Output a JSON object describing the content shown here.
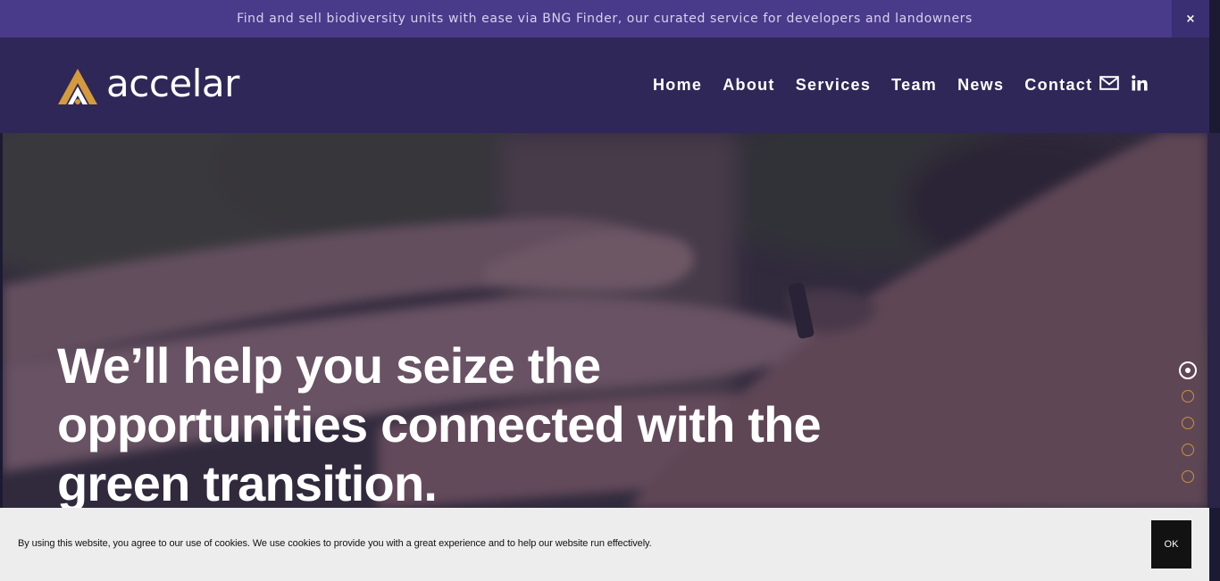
{
  "announcement": {
    "text": "Find and sell biodiversity units with ease via BNG Finder, our curated service for developers and landowners",
    "close_label": "×"
  },
  "header": {
    "logo_text": "accelar",
    "nav": [
      {
        "label": "Home"
      },
      {
        "label": "About"
      },
      {
        "label": "Services"
      },
      {
        "label": "Team"
      },
      {
        "label": "News"
      },
      {
        "label": "Contact"
      }
    ],
    "social_icons": [
      "mail-icon",
      "linkedin-icon"
    ]
  },
  "hero": {
    "title": "We’ll help you seize the opportunities connected with the green transition.",
    "slide_count": 5,
    "active_slide": 1
  },
  "cookie_banner": {
    "text": "By using this website, you agree to our use of cookies. We use cookies to provide you with a great experience and to help our website run effectively.",
    "ok_label": "OK"
  },
  "colors": {
    "announcement_bg": "#4a3a8a",
    "header_bg": "#2e2757",
    "brand_gold": "#c8953a",
    "cookie_bg": "#ededed",
    "cookie_button": "#121212"
  }
}
